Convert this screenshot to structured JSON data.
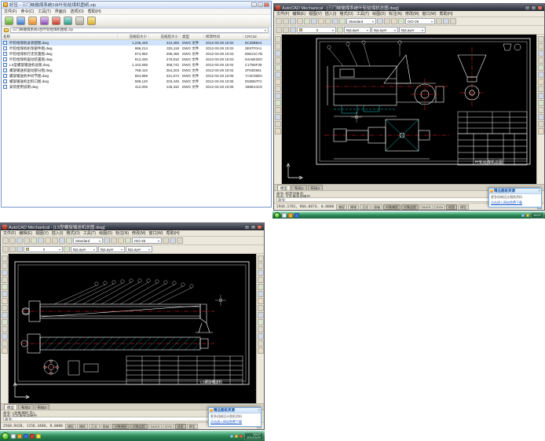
{
  "archive": {
    "title": "好压 - 三门峡输煤系统2台叶轮给煤机图纸.zip",
    "menus": [
      "文件(F)",
      "命令(C)",
      "工具(T)",
      "界面(I)",
      "选项(O)",
      "帮助(H)"
    ],
    "toolbar_icons": [
      "add-icon",
      "extract-icon",
      "test-icon",
      "view-icon",
      "delete-icon",
      "find-icon",
      "wizard-icon",
      "info-icon"
    ],
    "address": "三门峡输煤系统2台叶轮给煤机图纸.zip",
    "columns": [
      "名称",
      "压缩前大小",
      "压缩后大小",
      "类型",
      "修改时间",
      "CRC32"
    ],
    "rows": [
      {
        "name": "叶轮给煤机总装配图.dwg",
        "size": "1,236,448",
        "packed": "412,365",
        "type": "DWG 文件",
        "date": "2012-03-29 10:02",
        "crc": "8C39B844"
      },
      {
        "name": "叶轮给煤机机架部件图.dwg",
        "size": "986,214",
        "packed": "325,118",
        "type": "DWG 文件",
        "date": "2012-03-29 10:02",
        "crc": "3E97F0A1"
      },
      {
        "name": "叶轮给煤机行走装置图.dwg",
        "size": "874,992",
        "packed": "298,456",
        "type": "DWG 文件",
        "date": "2012-03-29 10:03",
        "crc": "65D21C7B"
      },
      {
        "name": "叶轮给煤机驱动装置图.dwg",
        "size": "812,330",
        "packed": "276,910",
        "type": "DWG 文件",
        "date": "2012-03-29 10:03",
        "crc": "94A8E2D0"
      },
      {
        "name": "LS型螺旋输送机总图.dwg",
        "size": "1,102,558",
        "packed": "368,742",
        "type": "DWG 文件",
        "date": "2012-03-29 10:04",
        "crc": "C17B5F39"
      },
      {
        "name": "螺旋输送机驱动部分图.dwg",
        "size": "768,410",
        "packed": "254,203",
        "type": "DWG 文件",
        "date": "2012-03-29 10:04",
        "crc": "2F84D961"
      },
      {
        "name": "螺旋输送机中间节图.dwg",
        "size": "654,889",
        "packed": "221,574",
        "type": "DWG 文件",
        "date": "2012-03-29 10:05",
        "crc": "7A3C90E5"
      },
      {
        "name": "螺旋输送机出料口图.dwg",
        "size": "598,120",
        "packed": "203,448",
        "type": "DWG 文件",
        "date": "2012-03-29 10:05",
        "crc": "D50B67F2"
      },
      {
        "name": "安装使用说明.dwg",
        "size": "412,006",
        "packed": "145,332",
        "type": "DWG 文件",
        "date": "2012-03-29 10:06",
        "crc": "1B9E44C8"
      }
    ]
  },
  "cad_common": {
    "menus": [
      "文件(F)",
      "编辑(E)",
      "视图(V)",
      "插入(I)",
      "格式(O)",
      "工具(T)",
      "绘图(D)",
      "标注(N)",
      "修改(M)",
      "窗口(W)",
      "帮助(H)"
    ],
    "style_combo": "Standard",
    "dim_combo": "ISO-25",
    "layer": "0",
    "color": "ByLayer",
    "linetype": "ByLayer",
    "lineweight": "ByLayer",
    "status_buttons": [
      "捕捉",
      "栅格",
      "正交",
      "极轴",
      "对象捕捉",
      "对象追踪",
      "DUCS",
      "DYN",
      "线宽",
      "模型"
    ],
    "tabs": [
      "模型",
      "布局1",
      "布局2"
    ]
  },
  "cad1": {
    "title": "AutoCAD Mechanical - [三门峡输煤系统叶轮给煤机总图.dwg]",
    "command_lines": [
      "命令: 指定对角点:",
      "命令: 正在重生成模型。",
      "命令:"
    ],
    "coords": "1944.1781, 866.0674, 0.0000",
    "drawing_label": "叶轮给煤机总图",
    "taskbar_time": "10:07"
  },
  "cad2": {
    "title": "AutoCAD Mechanical - [LS型螺旋输送机总图.dwg]",
    "command_lines": [
      "命令: <对象捕捉 开>",
      "命令: 正在重生成模型。",
      "命令:"
    ],
    "coords": "2568.9428, 1156.3408, 0.0000",
    "drawing_label": "LS螺旋输送机",
    "taskbar_time": "10:07",
    "taskbar_date": "2012/3/29"
  },
  "popup": {
    "title": "精品图纸资源",
    "line1": "更多机械设计图纸资料",
    "link": "点击进入网站免费下载"
  }
}
